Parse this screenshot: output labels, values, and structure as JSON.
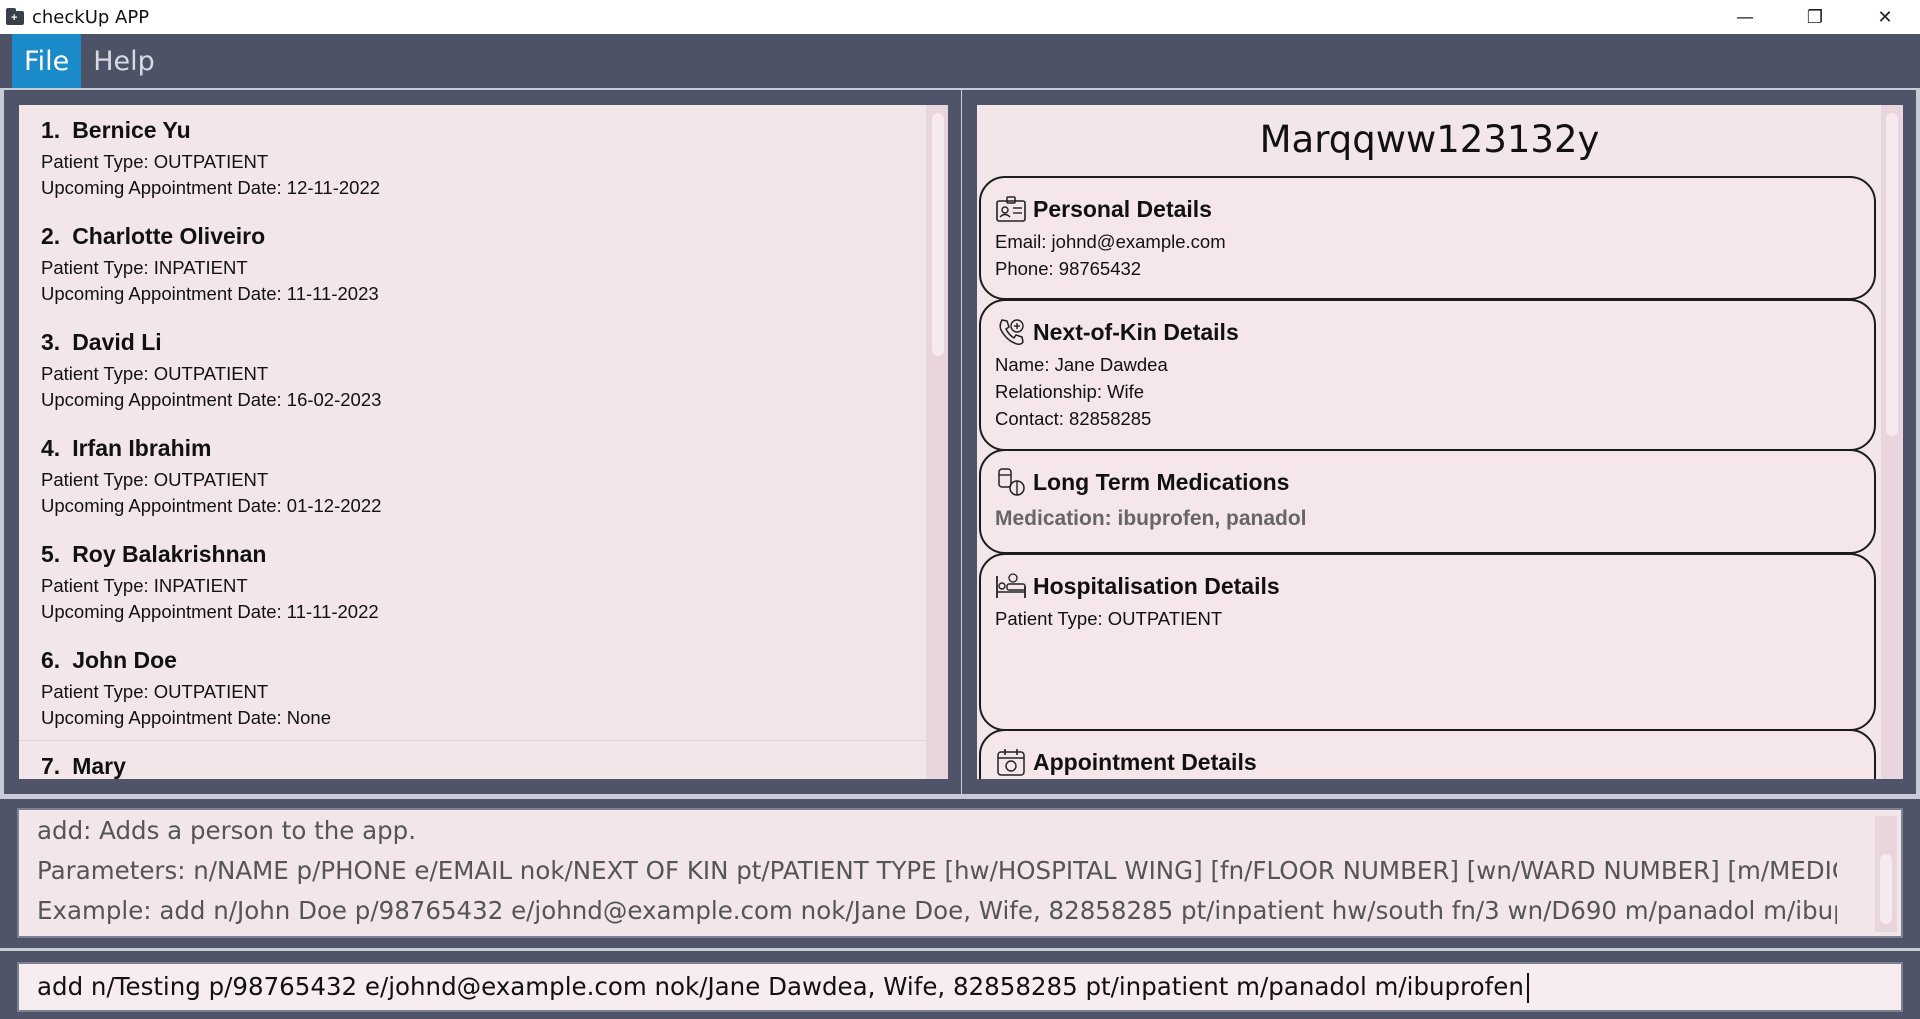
{
  "window": {
    "title": "checkUp APP",
    "controls": {
      "minimize": "—",
      "restore": "❐",
      "close": "✕"
    }
  },
  "menu": {
    "file": "File",
    "help": "Help"
  },
  "patients": [
    {
      "index": "1.",
      "name": "Bernice Yu",
      "type": "Patient Type: OUTPATIENT",
      "appointment": "Upcoming Appointment Date: 12-11-2022"
    },
    {
      "index": "2.",
      "name": "Charlotte Oliveiro",
      "type": "Patient Type: INPATIENT",
      "appointment": "Upcoming Appointment Date: 11-11-2023"
    },
    {
      "index": "3.",
      "name": "David Li",
      "type": "Patient Type: OUTPATIENT",
      "appointment": "Upcoming Appointment Date: 16-02-2023"
    },
    {
      "index": "4.",
      "name": "Irfan Ibrahim",
      "type": "Patient Type: OUTPATIENT",
      "appointment": "Upcoming Appointment Date: 01-12-2022"
    },
    {
      "index": "5.",
      "name": "Roy Balakrishnan",
      "type": "Patient Type: INPATIENT",
      "appointment": "Upcoming Appointment Date: 11-11-2022"
    },
    {
      "index": "6.",
      "name": "John Doe",
      "type": "Patient Type: OUTPATIENT",
      "appointment": "Upcoming Appointment Date: None"
    },
    {
      "index": "7.",
      "name": "Mary",
      "type": "",
      "appointment": ""
    }
  ],
  "detail": {
    "name": "Marqqww123132y",
    "personal": {
      "title": "Personal Details",
      "email": "Email: johnd@example.com",
      "phone": "Phone: 98765432"
    },
    "nok": {
      "title": "Next-of-Kin Details",
      "name": "Name: Jane Dawdea",
      "relationship": "Relationship: Wife",
      "contact": "Contact: 82858285"
    },
    "medications": {
      "title": "Long Term Medications",
      "medication": "Medication: ibuprofen, panadol"
    },
    "hospitalisation": {
      "title": "Hospitalisation Details",
      "patient_type": "Patient Type: OUTPATIENT"
    },
    "appointment": {
      "title": "Appointment Details"
    }
  },
  "result": {
    "line1": "add: Adds a person to the app.",
    "line2": "Parameters: n/NAME p/PHONE e/EMAIL nok/NEXT OF KIN pt/PATIENT TYPE [hw/HOSPITAL WING] [fn/FLOOR NUMBER] [wn/WARD NUMBER] [m/MEDICATION]...",
    "line3": "Example: add n/John Doe p/98765432 e/johnd@example.com nok/Jane Doe, Wife, 82858285 pt/inpatient hw/south fn/3 wn/D690 m/panadol m/ibuprofen"
  },
  "command": {
    "value": "add n/Testing p/98765432 e/johnd@example.com nok/Jane Dawdea, Wife, 82858285 pt/inpatient m/panadol m/ibuprofen"
  }
}
